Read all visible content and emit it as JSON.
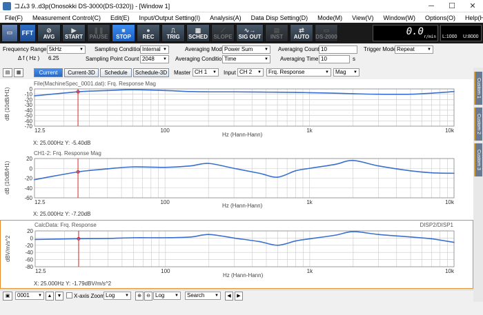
{
  "window": {
    "title": "コム3 9..d3p(Onosokki DS-3000(DS-0320)) - [Window 1]"
  },
  "menu": [
    "File(F)",
    "Measurement Control(C)",
    "Edit(E)",
    "Input/Output Setting(I)",
    "Analysis(A)",
    "Data Disp Setting(D)",
    "Mode(M)",
    "View(V)",
    "Window(W)",
    "Options(O)",
    "Help(H)"
  ],
  "toolbar": {
    "fft": "FFT",
    "avg": "AVG",
    "start": "START",
    "pause": "PAUSE",
    "stop": "STOP",
    "rec": "REC",
    "trig": "TRIG",
    "sched": "SCHED",
    "slope": "SLOPE",
    "sigout": "SIG OUT",
    "inst": "INST",
    "auto": "AUTO",
    "ds2000": "DS-2000",
    "rpm_value": "0.0",
    "rpm_unit": "r/min",
    "lower_limit": "L:1000",
    "upper_limit": "U:8000"
  },
  "conditions": {
    "freq_range_label": "Frequency Range",
    "freq_range_value": "5kHz",
    "delta_f_label": "Δ f ( Hz )",
    "delta_f_value": "6.25",
    "sampling_condition_label": "Sampling Condition",
    "sampling_condition_value": "Internal",
    "sampling_point_label": "Sampling Point Count",
    "sampling_point_value": "2048",
    "avg_mode_label": "Averaging Mode",
    "avg_mode_value": "Power Sum",
    "avg_condition_label": "Averaging Condition",
    "avg_condition_value": "Time",
    "avg_count_label": "Averaging Count",
    "avg_count_value": "10",
    "avg_time_label": "Averaging Time",
    "avg_time_value": "10",
    "avg_time_unit": "s",
    "trigger_mode_label": "Trigger Mode",
    "trigger_mode_value": "Repeat"
  },
  "tabs": {
    "current": "Current",
    "current3d": "Current-3D",
    "schedule": "Schedule",
    "schedule3d": "Schedule-3D",
    "master_label": "Master",
    "master_value": "CH 1",
    "input_label": "Input",
    "input_value": "CH 2",
    "func_value": "Frq. Response",
    "format_value": "Mag"
  },
  "graphs": [
    {
      "title": "File(MachineSpec_0001.dat): Frq. Response Mag",
      "ylabel": "dB (10dB/H1)",
      "yticks": [
        "0",
        "-10",
        "-20",
        "-30",
        "-40",
        "-50",
        "-60",
        "-70"
      ],
      "xticks": [
        "12.5",
        "100",
        "1k",
        "10k"
      ],
      "xlabel": "Hz (Hann-Hann)",
      "cursor": "X: 25.000Hz Y: -5.40dB",
      "right_title": ""
    },
    {
      "title": "CH1-2: Frq. Response Mag",
      "ylabel": "dB (10dB/H1)",
      "yticks": [
        "20",
        "0",
        "-20",
        "-40",
        "-60"
      ],
      "xticks": [
        "12.5",
        "100",
        "1k",
        "10k"
      ],
      "xlabel": "Hz (Hann-Hann)",
      "cursor": "X: 25.000Hz Y: -7.20dB",
      "right_title": ""
    },
    {
      "title": "CalcData: Frq. Response",
      "ylabel": "dBV/m/s^2",
      "yticks": [
        "20",
        "0",
        "-20",
        "-40",
        "-60",
        "-80"
      ],
      "xticks": [
        "12.5",
        "100",
        "1k",
        "10k"
      ],
      "xlabel": "Hz (Hann-Hann)",
      "cursor": "X: 25.000Hz Y: -1.79dBV/m/s^2",
      "right_title": "DISP2/DISP1"
    }
  ],
  "sidetabs": [
    "Custom 1",
    "Custom 2",
    "Custom 3"
  ],
  "statusbar": {
    "page": "0001",
    "xaxis_zoom": "X-axis Zoom",
    "xscale": "Log",
    "yscale": "Log",
    "search": "Search"
  },
  "colors": {
    "curve": "#3a6fd0",
    "cursor": "#e02020",
    "grid": "#c8c8c8",
    "selected_border": "#e88a2a"
  },
  "chart_data": [
    {
      "type": "line",
      "title": "File(MachineSpec_0001.dat): Frq. Response Mag",
      "xlabel": "Hz (Hann-Hann)",
      "ylabel": "dB (10dB/H1)",
      "xscale": "log",
      "xlim": [
        12.5,
        10000
      ],
      "ylim": [
        -70,
        0
      ],
      "x": [
        12.5,
        25,
        40,
        60,
        100,
        150,
        200,
        300,
        500,
        800,
        1000,
        1500,
        2000,
        3000,
        5000,
        7000,
        10000
      ],
      "y": [
        -13,
        -5.4,
        -3,
        -1.5,
        -3,
        -5,
        -5.5,
        -5.5,
        -6,
        -6.5,
        -7,
        -8,
        -9,
        -10,
        -10,
        -8,
        -5
      ]
    },
    {
      "type": "line",
      "title": "CH1-2: Frq. Response Mag",
      "xlabel": "Hz (Hann-Hann)",
      "ylabel": "dB (10dB/H1)",
      "xscale": "log",
      "xlim": [
        12.5,
        10000
      ],
      "ylim": [
        -60,
        20
      ],
      "x": [
        12.5,
        25,
        40,
        60,
        100,
        150,
        200,
        300,
        450,
        600,
        800,
        1000,
        1500,
        2000,
        3000,
        5000,
        7000,
        10000
      ],
      "y": [
        -23,
        -7.2,
        -1,
        3,
        2,
        5,
        10,
        0,
        -10,
        -18,
        -5,
        0,
        8,
        16,
        5,
        -5,
        -9,
        -10
      ]
    },
    {
      "type": "line",
      "title": "CalcData: Frq. Response",
      "xlabel": "Hz (Hann-Hann)",
      "ylabel": "dBV/m/s^2",
      "xscale": "log",
      "xlim": [
        12.5,
        10000
      ],
      "ylim": [
        -80,
        20
      ],
      "x": [
        12.5,
        25,
        40,
        60,
        100,
        150,
        200,
        300,
        450,
        600,
        800,
        1000,
        1500,
        2000,
        3000,
        5000,
        7000,
        10000
      ],
      "y": [
        -4,
        -1.8,
        -1,
        1,
        1,
        3,
        10,
        0,
        -10,
        -20,
        -8,
        -2,
        8,
        18,
        10,
        3,
        -2,
        -12
      ]
    }
  ]
}
